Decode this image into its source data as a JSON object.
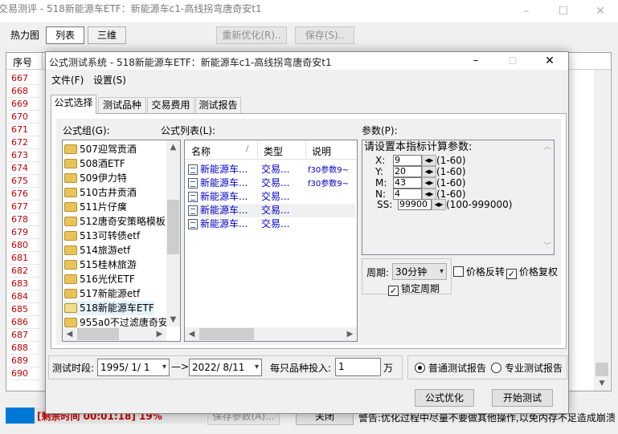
{
  "main_window": {
    "title": "交易测评 - 518新能源车ETF：新能源车c1-高线拐弯唐奇安t1",
    "view_buttons": [
      "热力图",
      "列表",
      "三维"
    ],
    "reoptimize_label": "重新优化(R)..",
    "save_label": "保存(S)..",
    "table_header": "序号",
    "row_numbers": [
      "667",
      "668",
      "669",
      "670",
      "671",
      "672",
      "673",
      "674",
      "675",
      "676",
      "677",
      "678",
      "679",
      "680",
      "681",
      "682",
      "683",
      "684",
      "685",
      "686",
      "687",
      "688",
      "689",
      "690"
    ],
    "status_text": "[剩余时间 00:01:18] 19%",
    "progress_percent": 19,
    "save_params_label": "保存参数(A)...",
    "close_label": "关闭",
    "warning_text": "警告:优化过程中尽量不要做其他操作,以免内存不足造成崩溃"
  },
  "dialog": {
    "title": "公式测试系统 - 518新能源车ETF：新能源车c1-高线拐弯唐奇安t1",
    "menu": [
      "文件(F)",
      "设置(S)"
    ],
    "tabs": [
      "公式选择",
      "测试品种",
      "交易费用",
      "测试报告"
    ],
    "group_label": "公式组(G):",
    "groups": [
      "507迎驾贡酒",
      "508酒ETF",
      "509伊力特",
      "510古井贡酒",
      "511片仔癀",
      "512唐奇安策略模板",
      "513可转债etf",
      "514旅游etf",
      "515桂林旅游",
      "516光伏ETF",
      "517新能源etf",
      "518新能源车ETF",
      "955a0不过滤唐奇安"
    ],
    "selected_group_index": 11,
    "formula_list_label": "公式列表(L):",
    "formula_columns": [
      "名称",
      "类型",
      "说明"
    ],
    "formulas": [
      {
        "name": "新能源车...",
        "type": "交易...",
        "desc": "f30参数9~"
      },
      {
        "name": "新能源车...",
        "type": "交易...",
        "desc": "f30参数9~"
      },
      {
        "name": "新能源车...",
        "type": "交易...",
        "desc": ""
      },
      {
        "name": "新能源车...",
        "type": "交易...",
        "desc": ""
      },
      {
        "name": "新能源车...",
        "type": "交易...",
        "desc": ""
      }
    ],
    "params_label": "参数(P):",
    "params_title": "请设置本指标计算参数:",
    "params": [
      {
        "name": "X:",
        "value": "9",
        "range": "(1-60)"
      },
      {
        "name": "Y:",
        "value": "20",
        "range": "(1-60)"
      },
      {
        "name": "M:",
        "value": "43",
        "range": "(1-60)"
      },
      {
        "name": "N:",
        "value": "4",
        "range": "(1-60)"
      }
    ],
    "ss_param": {
      "name": "SS:",
      "value": "99900",
      "range": "(100-999000)"
    },
    "period_label": "周期:",
    "period_value": "30分钟",
    "price_reverse_label": "价格反转",
    "price_reverse_checked": false,
    "price_adjust_label": "价格复权",
    "price_adjust_checked": true,
    "lock_period_label": "锁定周期",
    "lock_period_checked": true,
    "test_period_label": "测试时段:",
    "start_date": "1995/ 1/ 1",
    "arrow": "—>",
    "end_date": "2022/ 8/11",
    "invest_label": "每只品种投入:",
    "invest_value": "1",
    "invest_unit": "万",
    "report_normal_label": "普通测试报告",
    "report_pro_label": "专业测试报告",
    "report_selected": "normal",
    "optimize_label": "公式优化",
    "start_test_label": "开始测试"
  },
  "colors": {
    "row_number": "#c00000",
    "formula_text": "#0000c8",
    "progress": "#0078d7",
    "status_text": "#c00000"
  }
}
